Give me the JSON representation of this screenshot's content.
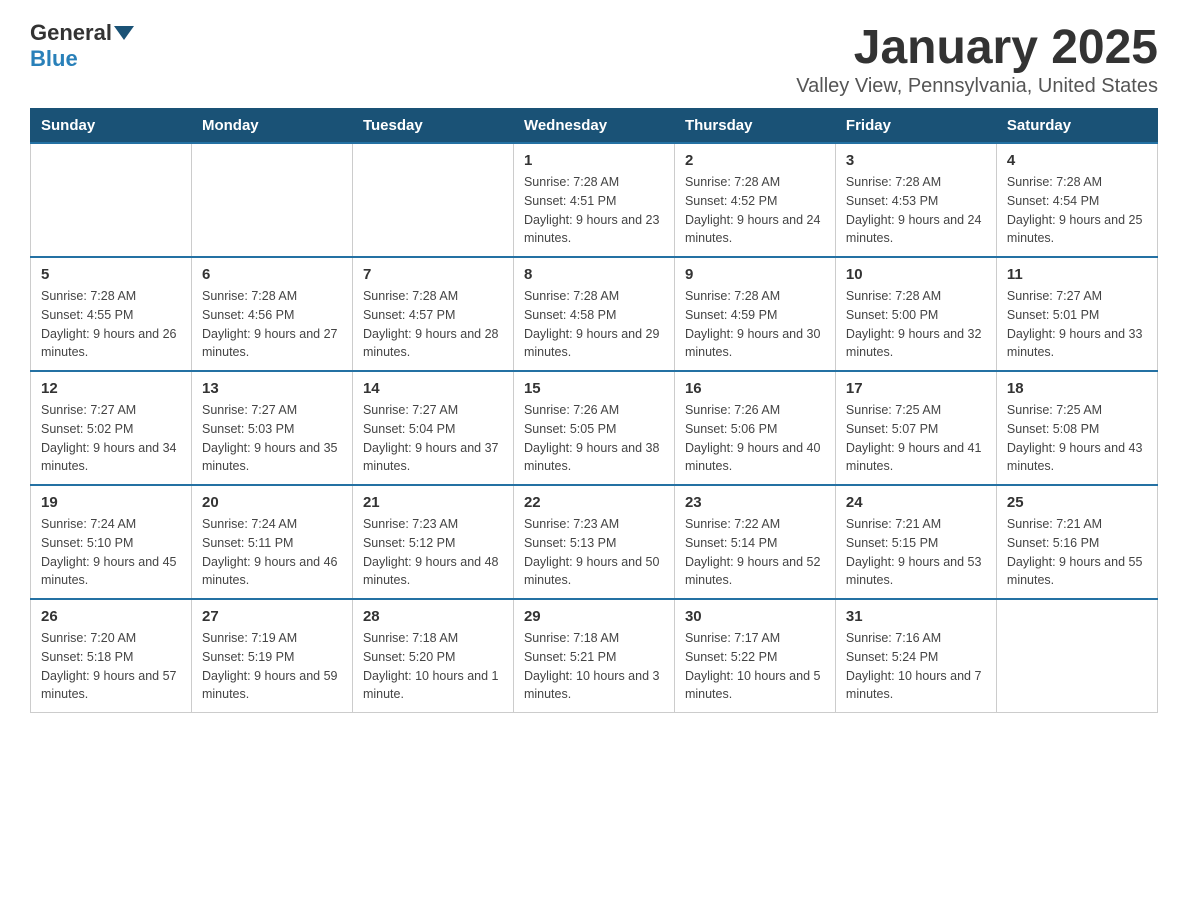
{
  "logo": {
    "general": "General",
    "blue": "Blue"
  },
  "header": {
    "title": "January 2025",
    "location": "Valley View, Pennsylvania, United States"
  },
  "days_of_week": [
    "Sunday",
    "Monday",
    "Tuesday",
    "Wednesday",
    "Thursday",
    "Friday",
    "Saturday"
  ],
  "weeks": [
    [
      {
        "day": "",
        "info": ""
      },
      {
        "day": "",
        "info": ""
      },
      {
        "day": "",
        "info": ""
      },
      {
        "day": "1",
        "info": "Sunrise: 7:28 AM\nSunset: 4:51 PM\nDaylight: 9 hours\nand 23 minutes."
      },
      {
        "day": "2",
        "info": "Sunrise: 7:28 AM\nSunset: 4:52 PM\nDaylight: 9 hours\nand 24 minutes."
      },
      {
        "day": "3",
        "info": "Sunrise: 7:28 AM\nSunset: 4:53 PM\nDaylight: 9 hours\nand 24 minutes."
      },
      {
        "day": "4",
        "info": "Sunrise: 7:28 AM\nSunset: 4:54 PM\nDaylight: 9 hours\nand 25 minutes."
      }
    ],
    [
      {
        "day": "5",
        "info": "Sunrise: 7:28 AM\nSunset: 4:55 PM\nDaylight: 9 hours\nand 26 minutes."
      },
      {
        "day": "6",
        "info": "Sunrise: 7:28 AM\nSunset: 4:56 PM\nDaylight: 9 hours\nand 27 minutes."
      },
      {
        "day": "7",
        "info": "Sunrise: 7:28 AM\nSunset: 4:57 PM\nDaylight: 9 hours\nand 28 minutes."
      },
      {
        "day": "8",
        "info": "Sunrise: 7:28 AM\nSunset: 4:58 PM\nDaylight: 9 hours\nand 29 minutes."
      },
      {
        "day": "9",
        "info": "Sunrise: 7:28 AM\nSunset: 4:59 PM\nDaylight: 9 hours\nand 30 minutes."
      },
      {
        "day": "10",
        "info": "Sunrise: 7:28 AM\nSunset: 5:00 PM\nDaylight: 9 hours\nand 32 minutes."
      },
      {
        "day": "11",
        "info": "Sunrise: 7:27 AM\nSunset: 5:01 PM\nDaylight: 9 hours\nand 33 minutes."
      }
    ],
    [
      {
        "day": "12",
        "info": "Sunrise: 7:27 AM\nSunset: 5:02 PM\nDaylight: 9 hours\nand 34 minutes."
      },
      {
        "day": "13",
        "info": "Sunrise: 7:27 AM\nSunset: 5:03 PM\nDaylight: 9 hours\nand 35 minutes."
      },
      {
        "day": "14",
        "info": "Sunrise: 7:27 AM\nSunset: 5:04 PM\nDaylight: 9 hours\nand 37 minutes."
      },
      {
        "day": "15",
        "info": "Sunrise: 7:26 AM\nSunset: 5:05 PM\nDaylight: 9 hours\nand 38 minutes."
      },
      {
        "day": "16",
        "info": "Sunrise: 7:26 AM\nSunset: 5:06 PM\nDaylight: 9 hours\nand 40 minutes."
      },
      {
        "day": "17",
        "info": "Sunrise: 7:25 AM\nSunset: 5:07 PM\nDaylight: 9 hours\nand 41 minutes."
      },
      {
        "day": "18",
        "info": "Sunrise: 7:25 AM\nSunset: 5:08 PM\nDaylight: 9 hours\nand 43 minutes."
      }
    ],
    [
      {
        "day": "19",
        "info": "Sunrise: 7:24 AM\nSunset: 5:10 PM\nDaylight: 9 hours\nand 45 minutes."
      },
      {
        "day": "20",
        "info": "Sunrise: 7:24 AM\nSunset: 5:11 PM\nDaylight: 9 hours\nand 46 minutes."
      },
      {
        "day": "21",
        "info": "Sunrise: 7:23 AM\nSunset: 5:12 PM\nDaylight: 9 hours\nand 48 minutes."
      },
      {
        "day": "22",
        "info": "Sunrise: 7:23 AM\nSunset: 5:13 PM\nDaylight: 9 hours\nand 50 minutes."
      },
      {
        "day": "23",
        "info": "Sunrise: 7:22 AM\nSunset: 5:14 PM\nDaylight: 9 hours\nand 52 minutes."
      },
      {
        "day": "24",
        "info": "Sunrise: 7:21 AM\nSunset: 5:15 PM\nDaylight: 9 hours\nand 53 minutes."
      },
      {
        "day": "25",
        "info": "Sunrise: 7:21 AM\nSunset: 5:16 PM\nDaylight: 9 hours\nand 55 minutes."
      }
    ],
    [
      {
        "day": "26",
        "info": "Sunrise: 7:20 AM\nSunset: 5:18 PM\nDaylight: 9 hours\nand 57 minutes."
      },
      {
        "day": "27",
        "info": "Sunrise: 7:19 AM\nSunset: 5:19 PM\nDaylight: 9 hours\nand 59 minutes."
      },
      {
        "day": "28",
        "info": "Sunrise: 7:18 AM\nSunset: 5:20 PM\nDaylight: 10 hours\nand 1 minute."
      },
      {
        "day": "29",
        "info": "Sunrise: 7:18 AM\nSunset: 5:21 PM\nDaylight: 10 hours\nand 3 minutes."
      },
      {
        "day": "30",
        "info": "Sunrise: 7:17 AM\nSunset: 5:22 PM\nDaylight: 10 hours\nand 5 minutes."
      },
      {
        "day": "31",
        "info": "Sunrise: 7:16 AM\nSunset: 5:24 PM\nDaylight: 10 hours\nand 7 minutes."
      },
      {
        "day": "",
        "info": ""
      }
    ]
  ]
}
